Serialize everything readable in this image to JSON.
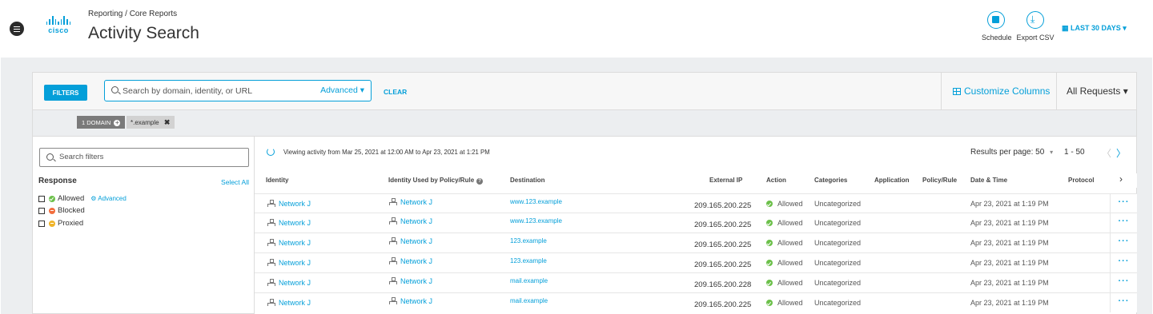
{
  "header": {
    "breadcrumb": "Reporting / Core Reports",
    "title": "Activity Search",
    "logo_text": "cisco",
    "schedule_label": "Schedule",
    "export_label": "Export CSV",
    "date_range": "LAST 30 DAYS"
  },
  "toolbar": {
    "filters_label": "FILTERS",
    "search_placeholder": "Search by domain, identity, or URL",
    "advanced_label": "Advanced",
    "clear_label": "CLEAR",
    "customize_columns": "Customize Columns",
    "all_requests": "All Requests"
  },
  "chips": {
    "count_label": "1 DOMAIN",
    "value": "*.example"
  },
  "left_panel": {
    "search_placeholder": "Search filters",
    "section_title": "Response",
    "select_all": "Select All",
    "advanced": "Advanced",
    "options": [
      {
        "label": "Allowed",
        "color": "#6cc04a"
      },
      {
        "label": "Blocked",
        "color": "#f26d3d"
      },
      {
        "label": "Proxied",
        "color": "#f0b429"
      }
    ]
  },
  "results": {
    "viewing_text": "Viewing activity from Mar 25, 2021 at 12:00 AM to Apr 23, 2021 at 1:21 PM",
    "per_page_label": "Results per page:",
    "per_page_value": "50",
    "range": "1 - 50"
  },
  "table": {
    "columns": [
      "Identity",
      "Identity Used by Policy/Rule",
      "Destination",
      "External IP",
      "Action",
      "Categories",
      "Application",
      "Policy/Rule",
      "Date & Time",
      "Protocol"
    ],
    "rows": [
      {
        "identity": "Network J",
        "policy_identity": "Network J",
        "destination": "www.123.example",
        "ip": "209.165.200.225",
        "action": "Allowed",
        "category": "Uncategorized",
        "datetime": "Apr 23, 2021 at 1:19 PM"
      },
      {
        "identity": "Network J",
        "policy_identity": "Network J",
        "destination": "www.123.example",
        "ip": "209.165.200.225",
        "action": "Allowed",
        "category": "Uncategorized",
        "datetime": "Apr 23, 2021 at 1:19 PM"
      },
      {
        "identity": "Network J",
        "policy_identity": "Network J",
        "destination": "123.example",
        "ip": "209.165.200.225",
        "action": "Allowed",
        "category": "Uncategorized",
        "datetime": "Apr 23, 2021 at 1:19 PM"
      },
      {
        "identity": "Network J",
        "policy_identity": "Network J",
        "destination": "123.example",
        "ip": "209.165.200.225",
        "action": "Allowed",
        "category": "Uncategorized",
        "datetime": "Apr 23, 2021 at 1:19 PM"
      },
      {
        "identity": "Network J",
        "policy_identity": "Network J",
        "destination": "mail.example",
        "ip": "209.165.200.228",
        "action": "Allowed",
        "category": "Uncategorized",
        "datetime": "Apr 23, 2021 at 1:19 PM"
      },
      {
        "identity": "Network J",
        "policy_identity": "Network J",
        "destination": "mail.example",
        "ip": "209.165.200.225",
        "action": "Allowed",
        "category": "Uncategorized",
        "datetime": "Apr 23, 2021 at 1:19 PM"
      }
    ]
  },
  "colors": {
    "accent": "#049fd9",
    "allowed": "#6cc04a"
  }
}
